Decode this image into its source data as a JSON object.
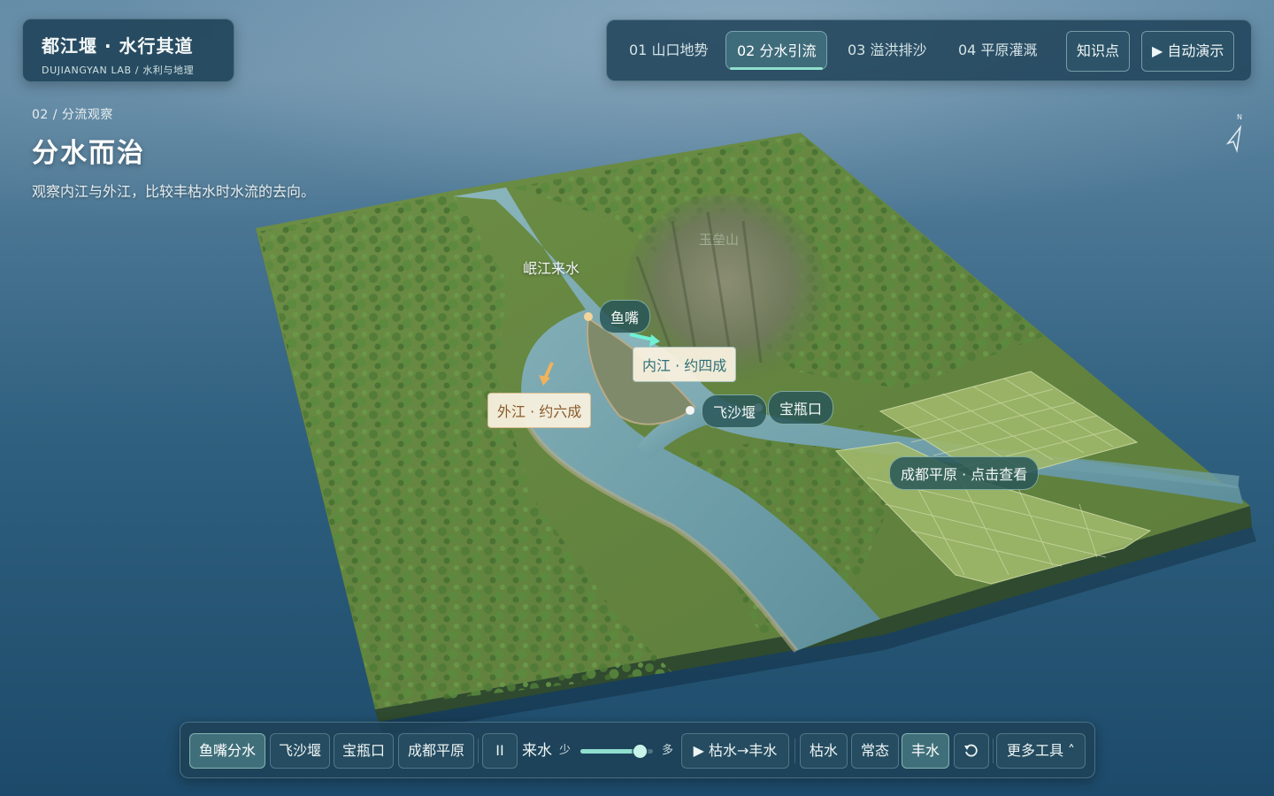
{
  "brand": {
    "title": "都江堰 · 水行其道",
    "subtitle": "DUJIANGYAN LAB / 水利与地理"
  },
  "steps": {
    "tabs": [
      {
        "label": "01 山口地势",
        "active": false
      },
      {
        "label": "02 分水引流",
        "active": true
      },
      {
        "label": "03 溢洪排沙",
        "active": false
      },
      {
        "label": "04 平原灌溉",
        "active": false
      }
    ],
    "knowledge_label": "知识点",
    "autoplay_label": "▶ 自动演示"
  },
  "step_info": {
    "crumb": "02 / 分流观察",
    "title": "分水而治",
    "description": "观察内江与外江，比较丰枯水时水流的去向。"
  },
  "compass": {
    "north_label": "N"
  },
  "map_labels": {
    "minjiang": "岷江来水",
    "yuzui": "鱼嘴",
    "neijiang": "内江 · 约四成",
    "waijiang": "外江 · 约六成",
    "feishayan": "飞沙堰",
    "baopingkou": "宝瓶口",
    "chengdu": "成都平原 · 点击查看",
    "mountain": "玉垒山"
  },
  "flow_split": {
    "inner_river_share": 0.4,
    "outer_river_share": 0.6
  },
  "toolbar": {
    "views": [
      {
        "label": "鱼嘴分水",
        "active": true
      },
      {
        "label": "飞沙堰",
        "active": false
      },
      {
        "label": "宝瓶口",
        "active": false
      },
      {
        "label": "成都平原",
        "active": false
      }
    ],
    "pause_label": "II",
    "flow_label": "来水",
    "flow_min_label": "少",
    "flow_max_label": "多",
    "flow_level": 0.82,
    "season_play_label": "▶ 枯水→丰水",
    "modes": [
      {
        "label": "枯水",
        "active": false
      },
      {
        "label": "常态",
        "active": false
      },
      {
        "label": "丰水",
        "active": true
      }
    ],
    "reset_icon": "refresh-icon",
    "more_tools_label": "更多工具 ˄"
  },
  "colors": {
    "accent": "#8fe0cf",
    "panel": "#1e4258",
    "river": "#6fa2ad",
    "terrain": "#6f8f45"
  }
}
